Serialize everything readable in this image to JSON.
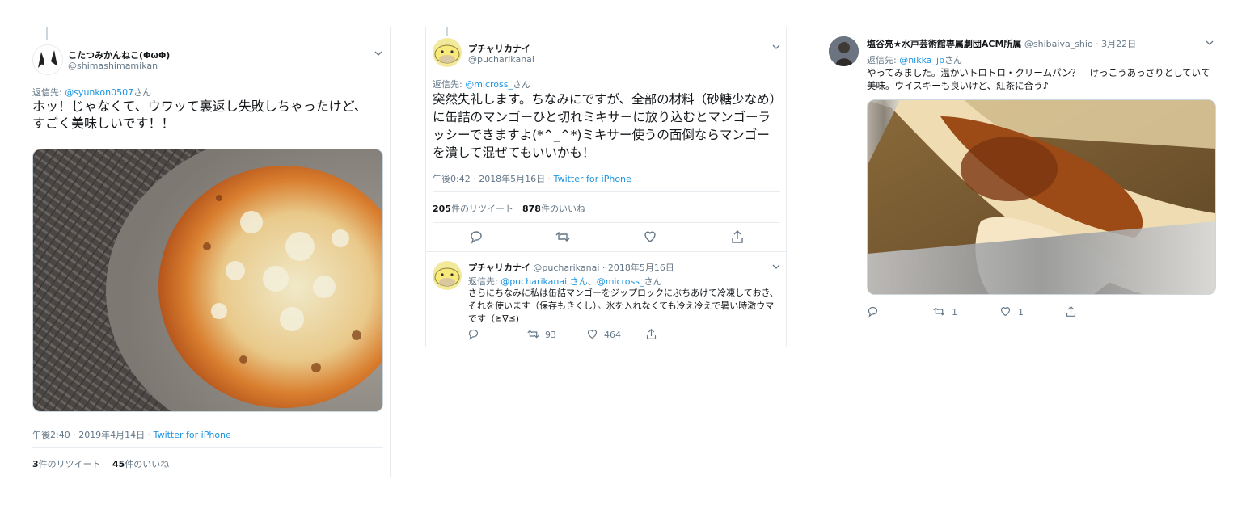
{
  "tweet1": {
    "display_name": "こたつみかんねこ(ΦωΦ)",
    "handle": "@shimashimamikan",
    "reply_prefix": "返信先: ",
    "reply_to": "@syunkon0507",
    "reply_suffix": "さん",
    "text": "ホッ！じゃなくて、ウワッて裏返し失敗しちゃったけど、すごく美味しいです！！",
    "time": "午後2:40 · 2019年4月14日 · ",
    "source": "Twitter for iPhone",
    "retweet_count": "3",
    "retweet_label": "件のリツイート",
    "like_count": "45",
    "like_label": "件のいいね"
  },
  "tweet2": {
    "display_name": "プチャリカナイ",
    "handle": "@pucharikanai",
    "reply_prefix": "返信先: ",
    "reply_to": "@micross_",
    "reply_suffix": "さん",
    "text": "突然失礼します。ちなみにですが、全部の材料（砂糖少なめ）に缶詰のマンゴーひと切れミキサーに放り込むとマンゴーラッシーできますよ(*^_^*)ミキサー使うの面倒ならマンゴーを潰して混ぜてもいいかも！",
    "time": "午後0:42 · 2018年5月16日 · ",
    "source": "Twitter for iPhone",
    "retweet_count": "205",
    "retweet_label": "件のリツイート",
    "like_count": "878",
    "like_label": "件のいいね"
  },
  "tweet3": {
    "display_name": "プチャリカナイ",
    "handle_date": "@pucharikanai · 2018年5月16日",
    "reply_prefix": "返信先: ",
    "reply_to1": "@pucharikanai さん",
    "reply_sep": "、",
    "reply_to2": "@micross_",
    "reply_suffix": "さん",
    "text": "さらにちなみに私は缶詰マンゴーをジップロックにぶちあけて冷凍しておき、それを使います（保存もきくし）。氷を入れなくても冷え冷えで暑い時激ウマです（≧∇≦)",
    "retweet_count": "93",
    "like_count": "464"
  },
  "tweet4": {
    "display_name": "塩谷亮★水戸芸術館専属劇団ACM所属",
    "handle_date": "@shibaiya_shio · 3月22日",
    "reply_prefix": "返信先: ",
    "reply_to": "@nikka_jp",
    "reply_suffix": "さん",
    "text": "やってみました。温かいトロトロ・クリームパン？　けっこうあっさりとしていて美味。ウイスキーも良いけど、紅茶に合う♪",
    "retweet_count": "1",
    "like_count": "1"
  },
  "icons": {
    "reply": "reply-icon",
    "retweet": "retweet-icon",
    "like": "heart-icon",
    "share": "share-icon",
    "more": "chevron-down-icon"
  },
  "colors": {
    "link": "#1b95e0",
    "muted": "#657786",
    "divider": "#e6ecf0"
  }
}
